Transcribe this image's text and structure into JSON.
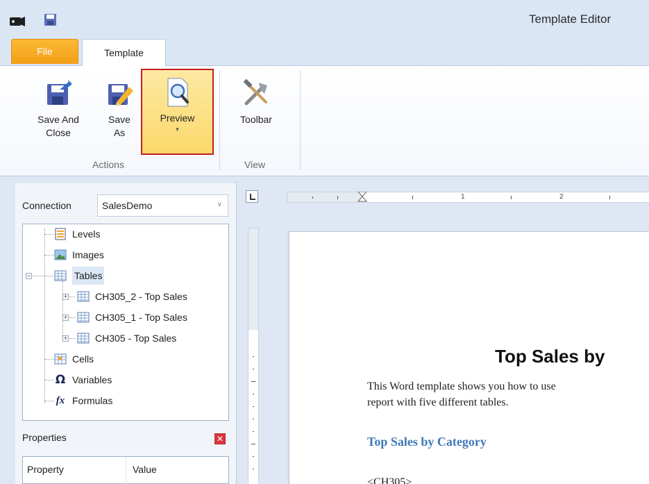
{
  "window": {
    "title": "Template Editor"
  },
  "quick_access": {
    "app_icon": "app-icon",
    "save_icon": "save-icon"
  },
  "tabs": [
    {
      "label": "File",
      "color": "#f5a623"
    },
    {
      "label": "Template"
    }
  ],
  "ribbon": {
    "groups": [
      {
        "label": "Actions",
        "buttons": [
          {
            "label_line1": "Save And",
            "label_line2": "Close",
            "icon": "save-and-close-icon"
          },
          {
            "label_line1": "Save",
            "label_line2": "As",
            "icon": "save-as-icon"
          },
          {
            "label_line1": "Preview",
            "caret": "▾",
            "icon": "preview-icon",
            "highlighted": true,
            "highlight_color": "#c41e22"
          }
        ]
      },
      {
        "label": "View",
        "buttons": [
          {
            "label_line1": "Toolbar",
            "icon": "toolbar-tools-icon"
          }
        ]
      }
    ]
  },
  "connection": {
    "label": "Connection",
    "value": "SalesDemo"
  },
  "tree": {
    "items": [
      {
        "label": "Levels",
        "icon": "levels-icon"
      },
      {
        "label": "Images",
        "icon": "images-icon"
      },
      {
        "label": "Tables",
        "icon": "table-icon",
        "expanded": true,
        "selected": true
      },
      {
        "label": "CH305_2 -  Top Sales",
        "icon": "table-icon",
        "expander": "+"
      },
      {
        "label": "CH305_1 -  Top Sales",
        "icon": "table-icon",
        "expander": "+"
      },
      {
        "label": "CH305 -  Top Sales",
        "icon": "table-icon",
        "expander": "+"
      },
      {
        "label": "Cells",
        "icon": "cells-icon"
      },
      {
        "label": "Variables",
        "icon": "omega-icon",
        "glyph": "Ω"
      },
      {
        "label": "Formulas",
        "icon": "fx-icon",
        "glyph": "fx"
      }
    ],
    "tables_expander": "−"
  },
  "properties": {
    "title": "Properties",
    "close_glyph": "✕",
    "columns": [
      "Property",
      "Value"
    ]
  },
  "ruler": {
    "h_numbers": [
      "1",
      "2"
    ]
  },
  "document": {
    "title": "Top Sales by",
    "intro_line1": "This Word template shows you how to use",
    "intro_line2": "report with five different tables.",
    "heading": "Top Sales by Category",
    "heading_color": "#3f78b8",
    "tag": "<CH305>"
  }
}
